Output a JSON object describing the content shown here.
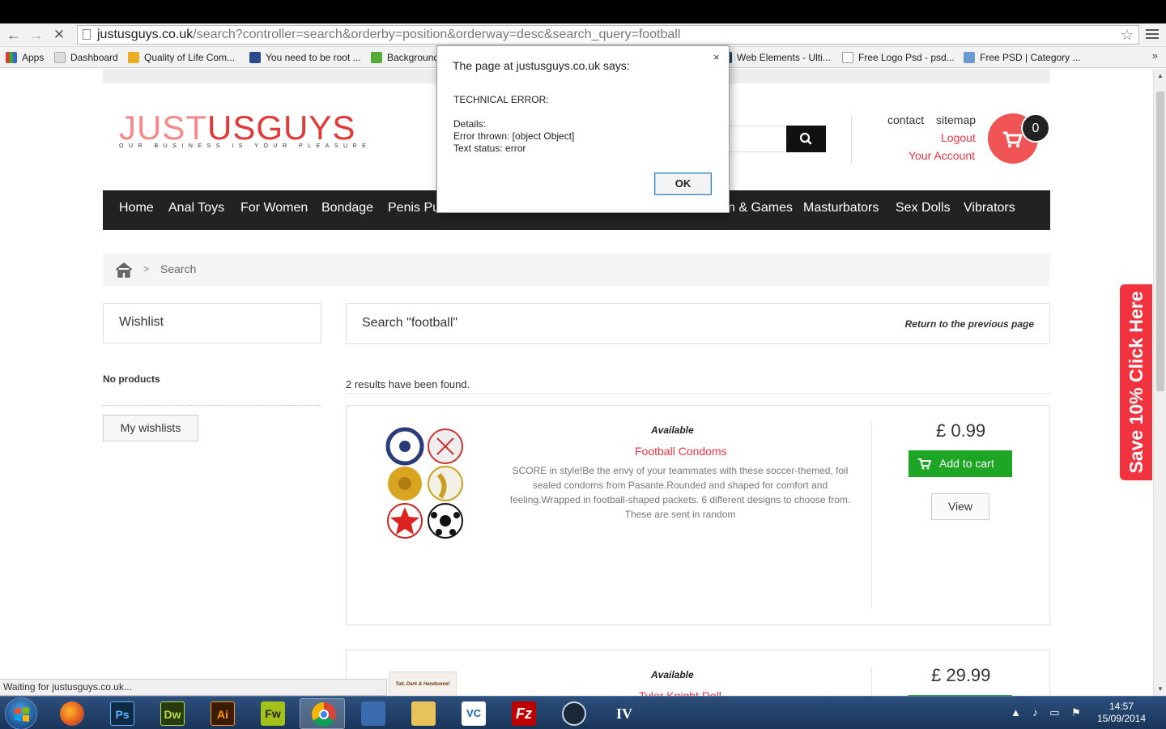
{
  "browser": {
    "url_host": "justusguys.co.uk",
    "url_path": "/search?controller=search&orderby=position&orderway=desc&search_query=football",
    "bookmarks": [
      "Apps",
      "Dashboard",
      "Quality of Life Com...",
      "You need to be root ...",
      "Background",
      "Web Elements - Ulti...",
      "Free Logo Psd - psd...",
      "Free PSD | Category ..."
    ],
    "bookmarks_more": "»",
    "status_text": "Waiting for justusguys.co.uk..."
  },
  "site": {
    "logo_part1": "JUST",
    "logo_part2": "USGUYS",
    "logo_tagline": "OUR BUSINESS IS YOUR PLEASURE",
    "header_links": {
      "contact": "contact",
      "sitemap": "sitemap",
      "logout": "Logout",
      "account": "Your Account"
    },
    "cart_count": "0",
    "nav": [
      "Home",
      "Anal Toys",
      "For Women",
      "Bondage",
      "Penis Pu",
      "n & Games",
      "Masturbators",
      "Sex Dolls",
      "Vibrators"
    ],
    "breadcrumb": {
      "sep": ">",
      "current": "Search"
    },
    "wishlist": {
      "title": "Wishlist",
      "empty": "No products",
      "button": "My wishlists"
    },
    "search": {
      "title": "Search \"football\"",
      "return": "Return to the previous page",
      "results": "2 results have been found."
    },
    "products": [
      {
        "availability": "Available",
        "name": "Football Condoms",
        "description": "SCORE in style!Be the envy of your teammates with these soccer-themed, foil sealed condoms from Pasante.Rounded and shaped for comfort and feeling.Wrapped in football-shaped packets. 6 different designs to choose from. These are sent in random",
        "price": "£ 0.99",
        "add_label": "Add to cart",
        "view_label": "View"
      },
      {
        "availability": "Available",
        "name": "Tyler Knight Doll",
        "price": "£ 29.99",
        "image_caption": "Tall, Dark & Handsome!"
      }
    ],
    "promo": "Save 10% Click Here"
  },
  "dialog": {
    "title": "The page at justusguys.co.uk says:",
    "close": "×",
    "body": "TECHNICAL ERROR:\n\nDetails:\nError thrown: [object Object]\nText status: error",
    "ok": "OK"
  },
  "taskbar": {
    "apps": [
      "firefox",
      "photoshop",
      "dreamweaver",
      "illustrator",
      "fireworks",
      "chrome",
      "network",
      "explorer",
      "vnc",
      "filezilla",
      "steam",
      "gta-iv"
    ],
    "time": "14:57",
    "date": "15/09/2014"
  },
  "colors": {
    "accent": "#f13340",
    "nav_bg": "#222222",
    "add_to_cart": "#1ca623"
  }
}
